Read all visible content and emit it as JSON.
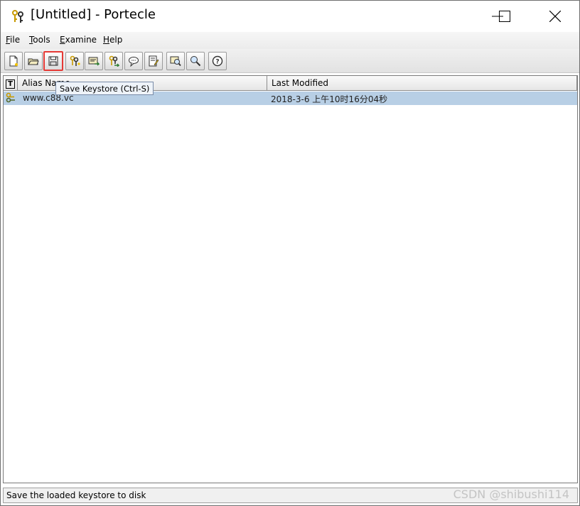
{
  "window": {
    "title": "[Untitled] - Portecle",
    "icon": "portecle-keys-icon",
    "controls": [
      "minimize-icon",
      "maximize-icon",
      "close-icon"
    ]
  },
  "menubar": {
    "items": [
      {
        "mnemonic": "F",
        "rest": "ile"
      },
      {
        "mnemonic": "T",
        "rest": "ools"
      },
      {
        "mnemonic": "E",
        "rest": "xamine"
      },
      {
        "mnemonic": "H",
        "rest": "elp"
      }
    ]
  },
  "toolbar": {
    "buttons": [
      {
        "icon": "new-keystore-icon"
      },
      {
        "icon": "open-keystore-icon"
      },
      {
        "icon": "save-keystore-icon",
        "highlighted": true
      },
      {
        "icon": "generate-keypair-icon"
      },
      {
        "icon": "import-certificate-icon"
      },
      {
        "icon": "import-keypair-icon"
      },
      {
        "icon": "keystore-password-icon"
      },
      {
        "icon": "keystore-report-icon"
      },
      {
        "icon": "examine-certificate-icon"
      },
      {
        "icon": "examine-crl-icon"
      },
      {
        "icon": "help-icon"
      }
    ],
    "tooltip": "Save Keystore (Ctrl-S)",
    "highlight_color": "#e53935"
  },
  "table": {
    "columns": {
      "type": "T",
      "alias": "Alias Name",
      "modified": "Last Modified"
    },
    "rows": [
      {
        "type_icon": "keypair-entry-icon",
        "alias": "www.c88.vc",
        "modified": "2018-3-6 上午10时16分04秒"
      }
    ],
    "selected_row_color": "#b8cfe5"
  },
  "status": {
    "text": "Save the loaded keystore to disk"
  },
  "watermark": "CSDN @shibushi114"
}
